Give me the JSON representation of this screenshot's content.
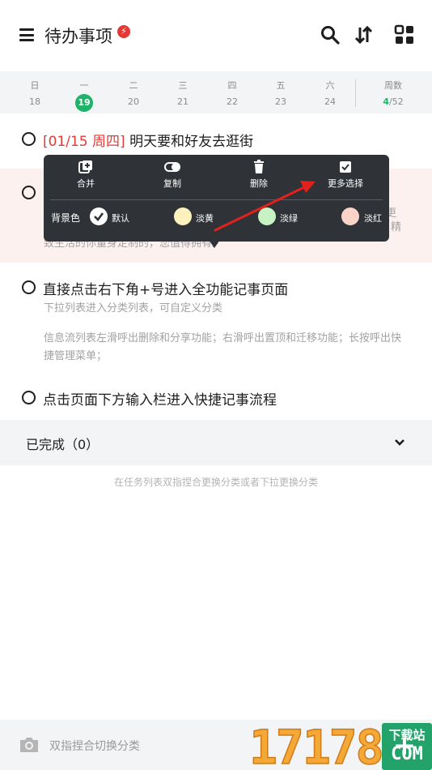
{
  "header": {
    "title": "待办事项",
    "badge": "⚡"
  },
  "calendar": {
    "days": [
      {
        "weekday": "日",
        "date": "18"
      },
      {
        "weekday": "一",
        "date": "19"
      },
      {
        "weekday": "二",
        "date": "20"
      },
      {
        "weekday": "三",
        "date": "21"
      },
      {
        "weekday": "四",
        "date": "22"
      },
      {
        "weekday": "五",
        "date": "23"
      },
      {
        "weekday": "六",
        "date": "24"
      }
    ],
    "week_label": "周数",
    "week_current": "4",
    "week_total": "/52"
  },
  "tasks": [
    {
      "date_tag": "[01/15 周四]",
      "title": "明天要和好友去逛街"
    },
    {
      "title": "",
      "note_visible_1": "更",
      "note_visible_2": "精",
      "note_bottom": "致生活的你量身定制的，您值得拥有。"
    },
    {
      "title": "直接点击右下角+号进入全功能记事页面",
      "note_1": "下拉列表进入分类列表，可自定义分类",
      "note_2": "信息流列表左滑呼出删除和分享功能；右滑呼出置顶和迁移功能；长按呼出快捷管理菜单；"
    },
    {
      "title": "点击页面下方输入栏进入快捷记事流程"
    }
  ],
  "popup": {
    "actions": [
      {
        "label": "合并",
        "icon": "merge-icon"
      },
      {
        "label": "复制",
        "icon": "copy-icon"
      },
      {
        "label": "删除",
        "icon": "trash-icon"
      },
      {
        "label": "更多选择",
        "icon": "checkbox-icon"
      }
    ],
    "bg_label": "背景色",
    "colors": [
      {
        "label": "默认",
        "color": "#ffffff"
      },
      {
        "label": "淡黄",
        "color": "#fdf1bd"
      },
      {
        "label": "淡绿",
        "color": "#c8f2c4"
      },
      {
        "label": "淡红",
        "color": "#fbd3c8"
      }
    ]
  },
  "completed": {
    "label": "已完成（0）"
  },
  "hint": "在任务列表双指捏合更换分类或者下拉更换分类",
  "bottom": {
    "placeholder": "双指捏合切换分类"
  },
  "watermark": {
    "digits": "17178",
    "badge_top": "下载站",
    "badge_bottom": "COM"
  },
  "colors": {
    "accent": "#1db36a",
    "date_red": "#e53935",
    "popup_bg": "#2f3237",
    "arrow": "#e3211c"
  }
}
